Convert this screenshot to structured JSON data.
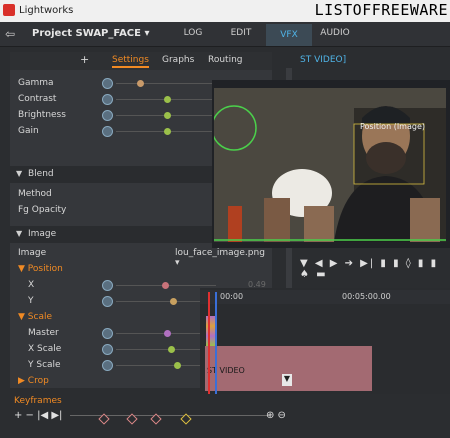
{
  "window": {
    "title": "Lightworks",
    "watermark": "LISTOFFREEWARE"
  },
  "project": {
    "exit_glyph": "⇦",
    "name": "Project SWAP_FACE ▾"
  },
  "main_tabs": [
    {
      "label": "LOG"
    },
    {
      "label": "EDIT"
    },
    {
      "label": "VFX"
    },
    {
      "label": "AUDIO"
    }
  ],
  "subtabs": {
    "add": "+",
    "settings": "Settings",
    "graphs": "Graphs",
    "routing": "Routing"
  },
  "colour_section": {
    "rows": [
      {
        "label": "Gamma"
      },
      {
        "label": "Contrast"
      },
      {
        "label": "Brightness"
      },
      {
        "label": "Gain"
      }
    ]
  },
  "blend_section": {
    "title": "Blend",
    "method_label": "Method",
    "opacity_label": "Fg Opacity"
  },
  "image_section": {
    "title": "Image",
    "image_label": "Image",
    "image_value": "lou_face_image.png ▾",
    "position_label": "Position",
    "x_label": "X",
    "x_ghost": "0.49",
    "y_label": "Y",
    "scale_label": "Scale",
    "master_label": "Master",
    "xscale_label": "X Scale",
    "yscale_label": "Y Scale",
    "crop_label": "Crop"
  },
  "viewer": {
    "header": "ST VIDEO]",
    "overlay_label": "Position (Image)"
  },
  "transport": {
    "glyphs": "▼ ◀ ▶ ➔ ▶| ▮ ▮ ◊ ▮ ▮ ♠ ▬"
  },
  "timeline": {
    "tc_start": "00:00",
    "tc_mid": "00:05:00.00",
    "clip_label": "ST VIDEO"
  },
  "keyframes": {
    "title": "Keyframes",
    "controls": "+ − |◀ ▶|"
  }
}
